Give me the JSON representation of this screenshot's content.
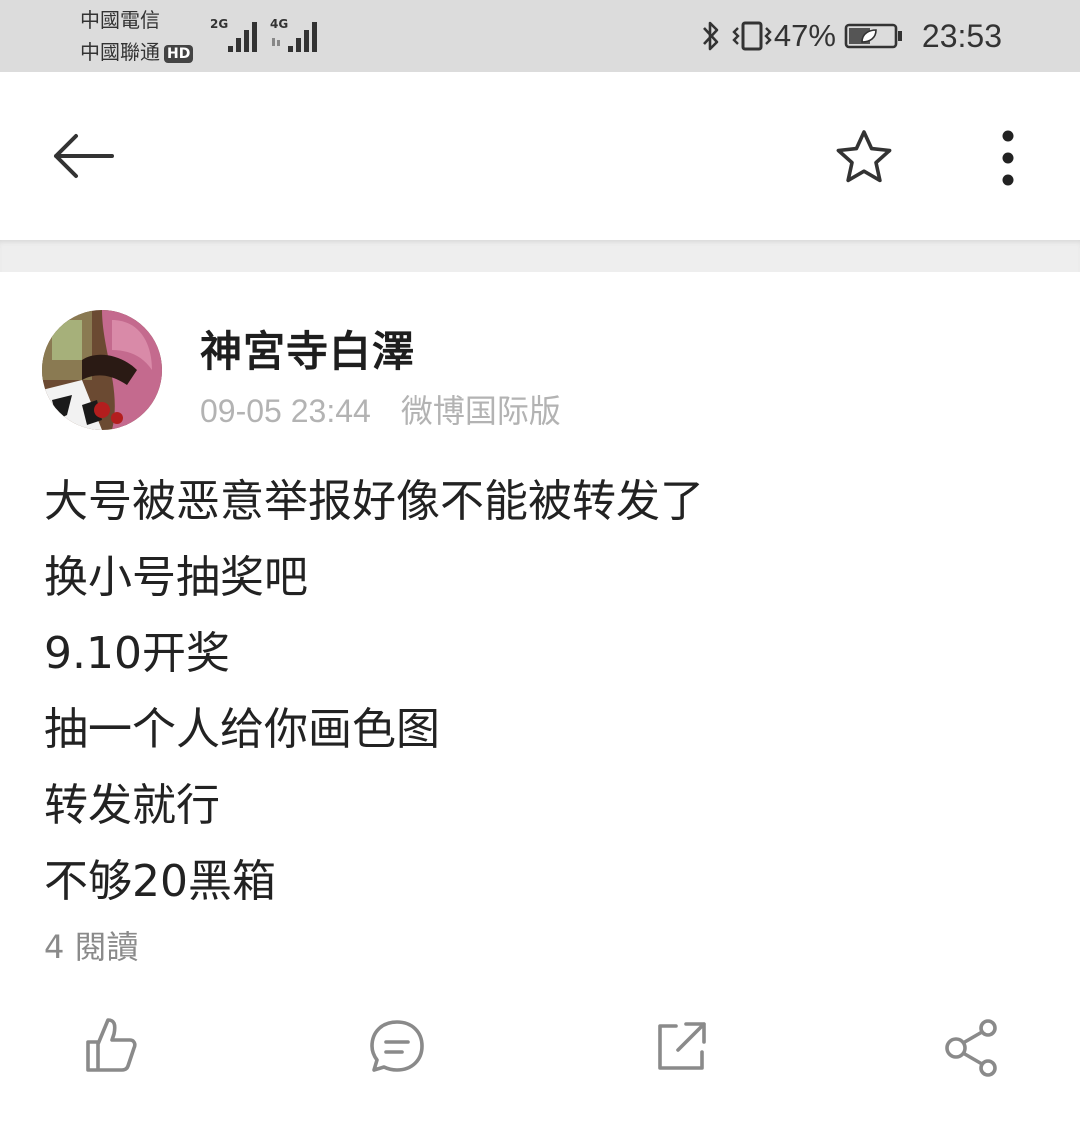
{
  "status_bar": {
    "carrier_1": "中國電信",
    "carrier_2": "中國聯通",
    "hd_label": "HD",
    "signal_1_tag": "2G",
    "signal_2_tag": "4G",
    "battery_percent": "47%",
    "battery_level": 0.47,
    "time": "23:53",
    "icons": [
      "bluetooth-icon",
      "vibrate-icon",
      "battery-icon"
    ]
  },
  "top_nav": {
    "icons": [
      "back-arrow-icon",
      "star-icon",
      "more-vertical-icon"
    ]
  },
  "post": {
    "username": "神宮寺白澤",
    "timestamp": "09-05 23:44",
    "source": "微博国际版",
    "lines": [
      "大号被恶意举报好像不能被转发了",
      "换小号抽奖吧",
      "9.10开奖",
      "抽一个人给你画色图",
      "转发就行",
      "不够20黑箱"
    ],
    "read_count": "4 閱讀"
  },
  "actions": {
    "icons": [
      "like-icon",
      "comment-icon",
      "repost-icon",
      "share-icon"
    ]
  },
  "colors": {
    "status_bar_bg": "#dcdcdc",
    "separator_bg": "#eeeeee",
    "meta_text": "#b3b3b3",
    "icon_gray": "#8a8a8a"
  }
}
